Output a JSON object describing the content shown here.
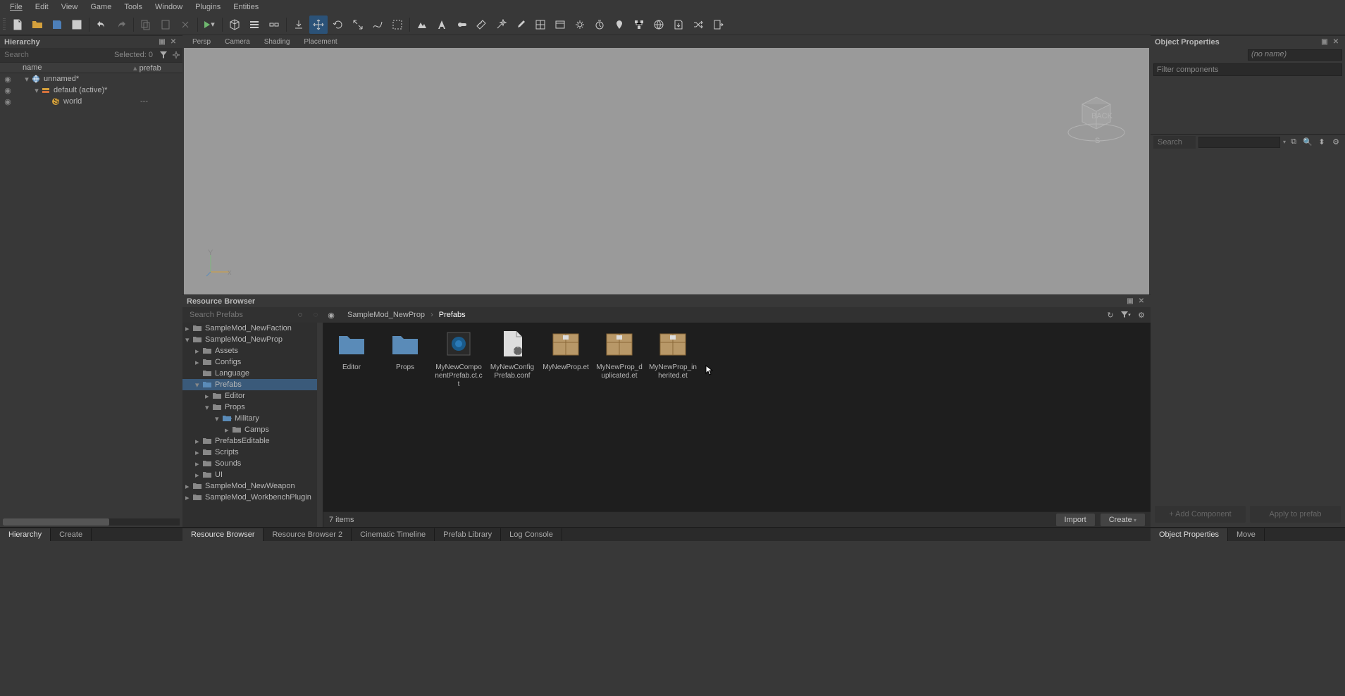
{
  "menu": {
    "file": "File",
    "edit": "Edit",
    "view": "View",
    "game": "Game",
    "tools": "Tools",
    "window": "Window",
    "plugins": "Plugins",
    "entities": "Entities"
  },
  "hierarchy": {
    "title": "Hierarchy",
    "search_ph": "Search",
    "selected": "Selected: 0",
    "col_name": "name",
    "col_prefab": "prefab",
    "rows": [
      {
        "label": "unnamed*",
        "indent": 0,
        "icon": "world",
        "expanded": true
      },
      {
        "label": "default (active)*",
        "indent": 1,
        "icon": "layer",
        "expanded": true
      },
      {
        "label": "world",
        "indent": 2,
        "icon": "s",
        "prefab": "---"
      }
    ]
  },
  "viewport": {
    "tabs": [
      "Persp",
      "Camera",
      "Shading",
      "Placement"
    ]
  },
  "resource_browser": {
    "title": "Resource Browser",
    "search_ph": "Search Prefabs",
    "breadcrumb": [
      "SampleMod_NewProp",
      "Prefabs"
    ],
    "tree": [
      {
        "label": "SampleMod_NewFaction",
        "indent": 0,
        "exp": "closed"
      },
      {
        "label": "SampleMod_NewProp",
        "indent": 0,
        "exp": "open"
      },
      {
        "label": "Assets",
        "indent": 1,
        "exp": "closed"
      },
      {
        "label": "Configs",
        "indent": 1,
        "exp": "closed"
      },
      {
        "label": "Language",
        "indent": 1,
        "exp": "none"
      },
      {
        "label": "Prefabs",
        "indent": 1,
        "exp": "open",
        "sel": true
      },
      {
        "label": "Editor",
        "indent": 2,
        "exp": "closed"
      },
      {
        "label": "Props",
        "indent": 2,
        "exp": "open"
      },
      {
        "label": "Military",
        "indent": 3,
        "exp": "open",
        "open_folder": true
      },
      {
        "label": "Camps",
        "indent": 4,
        "exp": "closed"
      },
      {
        "label": "PrefabsEditable",
        "indent": 1,
        "exp": "closed"
      },
      {
        "label": "Scripts",
        "indent": 1,
        "exp": "closed"
      },
      {
        "label": "Sounds",
        "indent": 1,
        "exp": "closed"
      },
      {
        "label": "UI",
        "indent": 1,
        "exp": "closed"
      },
      {
        "label": "SampleMod_NewWeapon",
        "indent": 0,
        "exp": "closed"
      },
      {
        "label": "SampleMod_WorkbenchPlugin",
        "indent": 0,
        "exp": "closed"
      }
    ],
    "items": [
      {
        "name": "Editor",
        "type": "folder"
      },
      {
        "name": "Props",
        "type": "folder"
      },
      {
        "name": "MyNewComponentPrefab.ct.ct",
        "type": "component"
      },
      {
        "name": "MyNewConfigPrefab.conf",
        "type": "config"
      },
      {
        "name": "MyNewProp.et",
        "type": "prefab"
      },
      {
        "name": "MyNewProp_duplicated.et",
        "type": "prefab"
      },
      {
        "name": "MyNewProp_inherited.et",
        "type": "prefab"
      }
    ],
    "status": "7 items",
    "import_btn": "Import",
    "create_btn": "Create"
  },
  "object_props": {
    "title": "Object Properties",
    "name_ph": "(no name)",
    "filter_ph": "Filter components",
    "search_ph": "Search",
    "add_comp": "+ Add Component",
    "apply": "Apply to prefab"
  },
  "bottom_tabs_left": [
    "Hierarchy",
    "Create"
  ],
  "bottom_tabs_mid": [
    "Resource Browser",
    "Resource Browser 2",
    "Cinematic Timeline",
    "Prefab Library",
    "Log Console"
  ],
  "bottom_tabs_right": [
    "Object Properties",
    "Move"
  ]
}
